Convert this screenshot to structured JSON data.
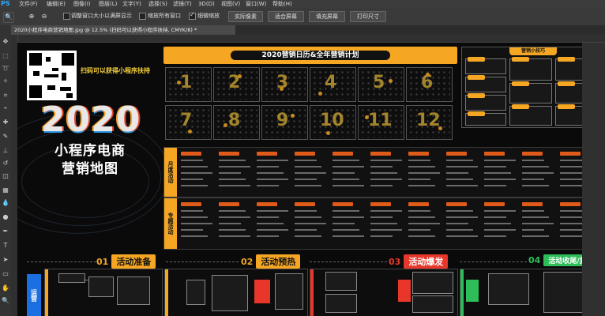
{
  "app": {
    "logo": "PS"
  },
  "menu": [
    "文件(F)",
    "编辑(E)",
    "图像(I)",
    "图层(L)",
    "文字(Y)",
    "选择(S)",
    "滤镜(T)",
    "3D(D)",
    "视图(V)",
    "窗口(W)",
    "帮助(H)"
  ],
  "options": {
    "resize_windows_label": "调整窗口大小以满屏显示",
    "zoom_all_label": "缩放所有窗口",
    "scrubby_zoom_label": "细微缩放",
    "actual_pixels": "实际像素",
    "fit_screen": "适合屏幕",
    "fill_screen": "填充屏幕",
    "print_size": "打印尺寸"
  },
  "document_tab": "2020小程序电商营销地图.jpg @ 12.5% (扫码可以获得小程序扶持, CMYK/8) *",
  "poster": {
    "scan_text": "扫码可以获得小程序扶持",
    "year": "2020",
    "title_line1": "小程序电商",
    "title_line2": "营销地图",
    "calendar_title": "2020营销日历&全年营销计划",
    "months": [
      "1",
      "2",
      "3",
      "4",
      "5",
      "6",
      "7",
      "8",
      "9",
      "10",
      "11",
      "12"
    ],
    "side_title": "营销小技巧",
    "monthly_label": "月度活动",
    "special_label": "专题活动",
    "phases": [
      {
        "num": "01",
        "label": "活动准备",
        "color": "#f5a623"
      },
      {
        "num": "02",
        "label": "活动预热",
        "color": "#f5a623"
      },
      {
        "num": "03",
        "label": "活动爆发",
        "color": "#e8372a"
      },
      {
        "num": "04",
        "label": "活动收尾/复盘",
        "color": "#2ebd59"
      }
    ],
    "ops_label": "运营"
  },
  "colors": {
    "accent": "#f5a623",
    "red": "#e8372a",
    "green": "#2ebd59",
    "blue": "#1b6fe0"
  }
}
